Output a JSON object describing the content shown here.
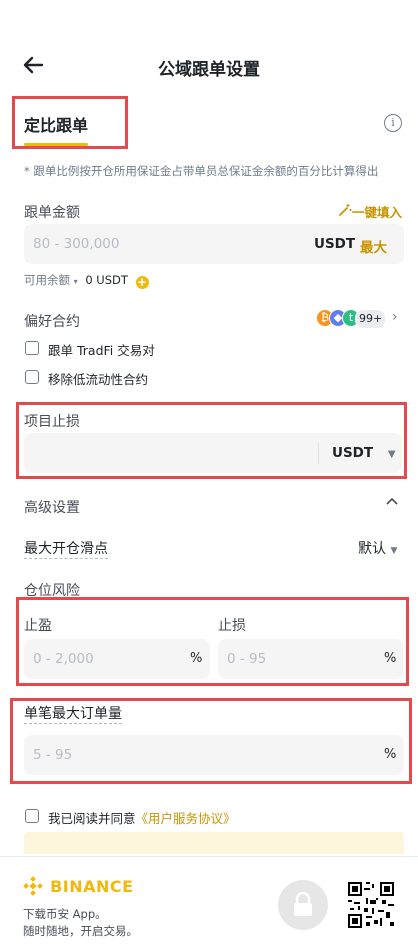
{
  "header": {
    "title": "公域跟单设置"
  },
  "tab": {
    "label": "定比跟单"
  },
  "note": "* 跟单比例按开仓所用保证金占带单员总保证金余额的百分比计算得出",
  "amount": {
    "label": "跟单金额",
    "quick_fill": "一键填入",
    "placeholder": "80 - 300,000",
    "unit": "USDT",
    "max": "最大",
    "available_label": "可用余额",
    "available_value": "0 USDT"
  },
  "contracts": {
    "label": "偏好合约",
    "more_count": "99+",
    "options": [
      "跟单 TradFi 交易对",
      "移除低流动性合约"
    ]
  },
  "project_stop_loss": {
    "label": "项目止损",
    "unit": "USDT"
  },
  "advanced": {
    "label": "高级设置",
    "slippage_label": "最大开仓滑点",
    "slippage_value": "默认",
    "risk_label": "仓位风险",
    "take_profit": {
      "label": "止盈",
      "placeholder": "0 - 2,000",
      "unit": "%"
    },
    "stop_loss": {
      "label": "止损",
      "placeholder": "0 - 95",
      "unit": "%"
    },
    "max_order": {
      "label": "单笔最大订单量",
      "placeholder": "5 - 95",
      "unit": "%"
    }
  },
  "agreement": {
    "text": "我已阅读并同意",
    "link": "《用户服务协议》"
  },
  "footer": {
    "brand": "BINANCE",
    "line1": "下载币安 App。",
    "line2": "随时随地，开启交易。"
  },
  "colors": {
    "accent": "#f0b90b",
    "link": "#c99400",
    "highlight": "#e5484d"
  }
}
